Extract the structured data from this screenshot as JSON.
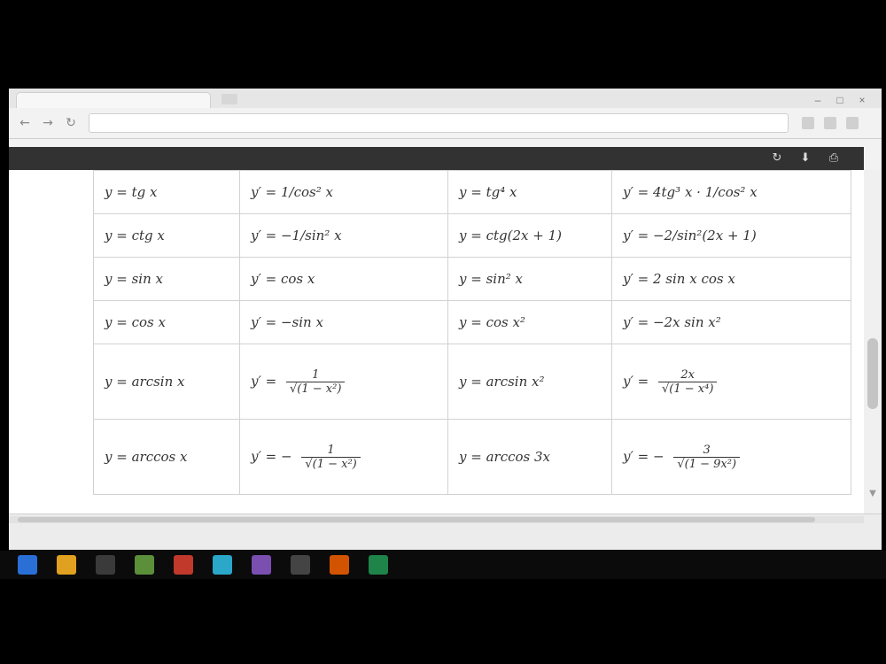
{
  "browser": {
    "tab_title": "",
    "url": "",
    "window_controls": {
      "minimize": "–",
      "maximize": "□",
      "close": "×"
    },
    "nav": {
      "back": "←",
      "forward": "→",
      "reload": "↻"
    }
  },
  "viewer": {
    "title": "",
    "page_indicator": "",
    "buttons": {
      "rotate": "↻",
      "download": "⬇",
      "print": "⎙"
    }
  },
  "table": {
    "rows": [
      [
        "y = tg x",
        "y′ = 1/cos² x",
        "y = tg⁴ x",
        "y′ = 4tg³ x · 1/cos² x"
      ],
      [
        "y = ctg x",
        "y′ = −1/sin² x",
        "y = ctg(2x + 1)",
        "y′ = −2/sin²(2x + 1)"
      ],
      [
        "y = sin x",
        "y′ = cos x",
        "y = sin² x",
        "y′ = 2 sin x cos x"
      ],
      [
        "y = cos x",
        "y′ = −sin x",
        "y = cos x²",
        "y′ = −2x sin x²"
      ],
      [
        "y = arcsin x",
        {
          "prefix": "y′ =",
          "num": "1",
          "den": "√(1 − x²)"
        },
        "y = arcsin x²",
        {
          "prefix": "y′ =",
          "num": "2x",
          "den": "√(1 − x⁴)"
        }
      ],
      [
        "y = arccos x",
        {
          "prefix": "y′ = −",
          "num": "1",
          "den": "√(1 − x²)"
        },
        "y = arccos 3x",
        {
          "prefix": "y′ = −",
          "num": "3",
          "den": "√(1 − 9x²)"
        }
      ]
    ]
  },
  "status": {
    "left": "",
    "right": ""
  },
  "taskbar": {
    "tray": "",
    "time": "",
    "date": "",
    "icon_colors": [
      "#2a6fd6",
      "#e0a020",
      "#3a3a3a",
      "#5b8f3a",
      "#c0392b",
      "#2aa7c9",
      "#7a4fb0",
      "#444444",
      "#d35400",
      "#1e8449"
    ]
  }
}
